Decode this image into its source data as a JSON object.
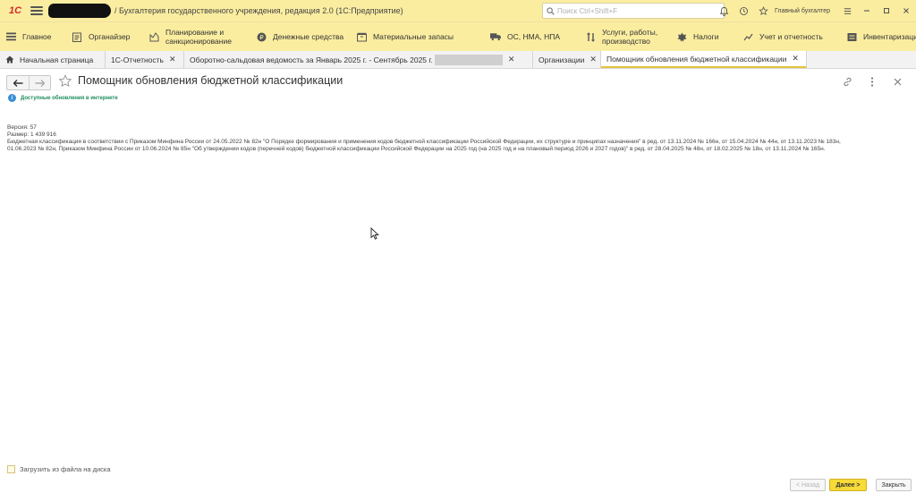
{
  "titlebar": {
    "logo": "1С",
    "app_title": "/ Бухгалтерия государственного учреждения, редакция 2.0  (1С:Предприятие)",
    "search_placeholder": "Поиск Ctrl+Shift+F",
    "user": "Главный бухгалтер",
    "icons": [
      "bell-icon",
      "history-icon",
      "star-icon",
      "settings-icon",
      "minimize-icon",
      "restore-icon",
      "close-icon"
    ]
  },
  "sections": [
    {
      "label": "Главное",
      "icon": "menu-lines-icon"
    },
    {
      "label": "Органайзер",
      "icon": "organizer-icon"
    },
    {
      "label": "Планирование и\nсанкционирование",
      "icon": "planning-icon"
    },
    {
      "label": "Денежные средства",
      "icon": "money-icon"
    },
    {
      "label": "Материальные запасы",
      "icon": "stock-icon"
    },
    {
      "label": "ОС, НМА, НПА",
      "icon": "truck-icon"
    },
    {
      "label": "Услуги, работы,\nпроизводство",
      "icon": "services-icon"
    },
    {
      "label": "Налоги",
      "icon": "taxes-icon"
    },
    {
      "label": "Учет и отчетность",
      "icon": "reporting-icon"
    },
    {
      "label": "Инвентаризация",
      "icon": "inventory-icon"
    }
  ],
  "tabs": [
    {
      "label": "Начальная страница",
      "closable": false
    },
    {
      "label": "1С-Отчетность",
      "closable": true
    },
    {
      "label": "Оборотно-сальдовая ведомость за Январь 2025 г. - Сентябрь 2025 г.",
      "closable": true
    },
    {
      "label": "Организации",
      "closable": true
    },
    {
      "label": "Помощник обновления бюджетной классификации",
      "closable": true,
      "active": true
    }
  ],
  "form": {
    "title": "Помощник обновления бюджетной классификации",
    "info": "Доступные обновления в интернете",
    "version": "Версия: 57",
    "size": "Размер: 1 439 916",
    "description_line1": "Бюджетная классификация в соответствии с Приказом Минфина России от 24.05.2022 № 82н \"О Порядке формирования и применения кодов бюджетной классификации Российской Федерации, их структуре и принципах назначения\" в ред. от 13.11.2024 № 166н, от 15.04.2024 № 44н, от 13.11.2023 № 183н,",
    "description_line2": "01.06.2023 № 82н, Приказом Минфина России от 10.06.2024 № 85н \"Об утверждении кодов (перечней кодов) бюджетной классификации Российской Федерации на 2025 год (на 2025 год и на плановый период 2026 и 2027 годов)\" в ред. от 28.04.2025 № 48н, от 18.02.2025 № 18н, от 13.11.2024 № 165н."
  },
  "footer": {
    "load_from_disk": "Загрузить из файла на диска",
    "back": "< Назад",
    "next": "Далее >",
    "close": "Закрыть"
  },
  "colors": {
    "panel_yellow": "#fbeda0",
    "primary_button": "#f8da38",
    "info_green": "#1c8c5a",
    "info_blue": "#3a8fd6"
  }
}
